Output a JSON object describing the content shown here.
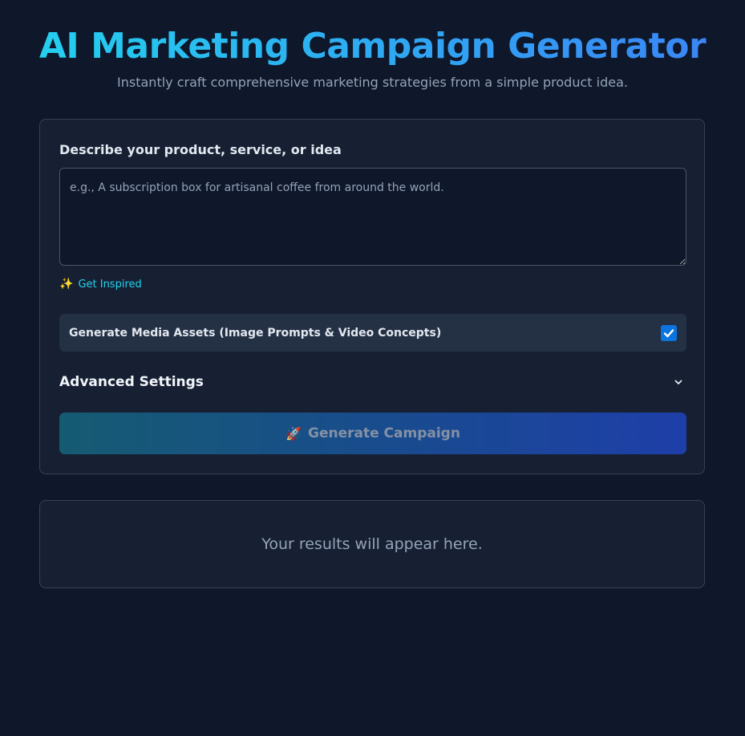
{
  "header": {
    "title": "AI Marketing Campaign Generator",
    "subtitle": "Instantly craft comprehensive marketing strategies from a simple product idea."
  },
  "form": {
    "description_label": "Describe your product, service, or idea",
    "description_value": "",
    "description_placeholder": "e.g., A subscription box for artisanal coffee from around the world.",
    "inspire_icon": "sparkles-icon",
    "inspire_label": "Get Inspired",
    "media_assets_label": "Generate Media Assets (Image Prompts & Video Concepts)",
    "media_assets_checked": true,
    "advanced_settings_label": "Advanced Settings",
    "advanced_settings_expanded": false,
    "generate_icon": "rocket-icon",
    "generate_label": "Generate Campaign",
    "generate_disabled": true
  },
  "results": {
    "placeholder": "Your results will appear here."
  },
  "colors": {
    "background": "#0f172a",
    "card": "#172033",
    "accent_cyan": "#22d3ee",
    "accent_blue": "#3b82f6",
    "checkbox": "#0b74de"
  }
}
